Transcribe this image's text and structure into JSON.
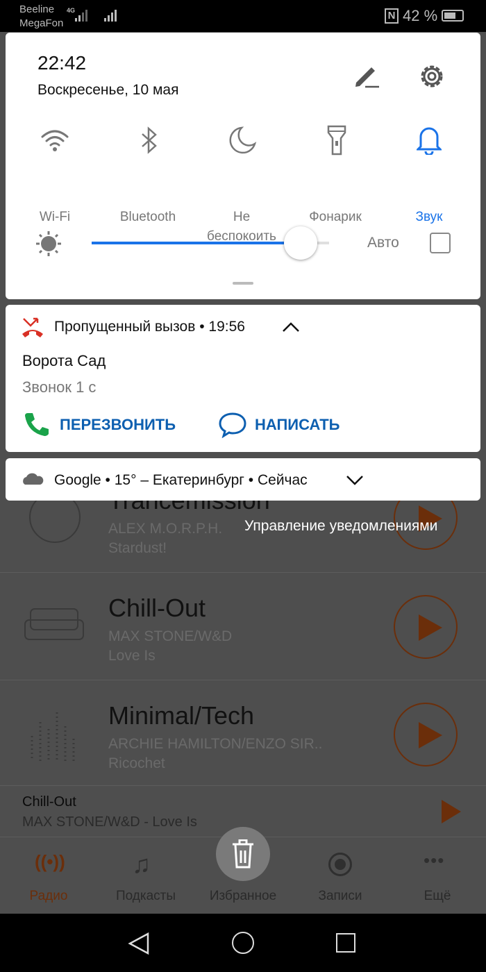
{
  "status_bar": {
    "carrier1": "Beeline",
    "carrier2": "MegaFon",
    "network": "4G",
    "battery": "42 %",
    "icons": [
      "signal-icon",
      "nfc-icon",
      "battery-icon"
    ]
  },
  "quick_settings": {
    "time": "22:42",
    "date": "Воскресенье, 10 мая",
    "toggles": [
      {
        "label": "Wi-Fi",
        "icon": "wifi-icon",
        "active": false
      },
      {
        "label": "Bluetooth",
        "icon": "bluetooth-icon",
        "active": false
      },
      {
        "label": "Не беспокоить",
        "icon": "moon-icon",
        "active": false
      },
      {
        "label": "Фонарик",
        "icon": "flashlight-icon",
        "active": false
      },
      {
        "label": "Звук",
        "icon": "bell-icon",
        "active": true
      }
    ],
    "brightness": 0.88,
    "auto_label": "Авто",
    "auto_checked": false,
    "accent": "#1a73e8"
  },
  "missed_call": {
    "header": "Пропущенный вызов • 19:56",
    "caller": "Ворота Сад",
    "detail": "Звонок 1 с",
    "call_back": "ПЕРЕЗВОНИТЬ",
    "message": "НАПИСАТЬ",
    "accent": "#0d5fb0"
  },
  "weather": {
    "text": "Google • 15° – Екатеринбург • Сейчас"
  },
  "manage_notifications": "Управление уведомлениями",
  "stations": [
    {
      "title": "Trancemission",
      "artist": "ALEX M.O.R.P.H.",
      "track": "Stardust!"
    },
    {
      "title": "Chill-Out",
      "artist": "MAX STONE/W&D",
      "track": "Love Is"
    },
    {
      "title": "Minimal/Tech",
      "artist": "ARCHIE HAMILTON/ENZO SIR..",
      "track": "Ricochet"
    }
  ],
  "mini_player": {
    "title": "Chill-Out",
    "subtitle": "MAX STONE/W&D - Love Is"
  },
  "bottom_nav": [
    {
      "label": "Радио",
      "active": true
    },
    {
      "label": "Подкасты"
    },
    {
      "label": "Избранное"
    },
    {
      "label": "Записи"
    },
    {
      "label": "Ещё"
    }
  ],
  "colors": {
    "brand": "#6b2e0a",
    "dim_bg": "#4e4e4e"
  }
}
